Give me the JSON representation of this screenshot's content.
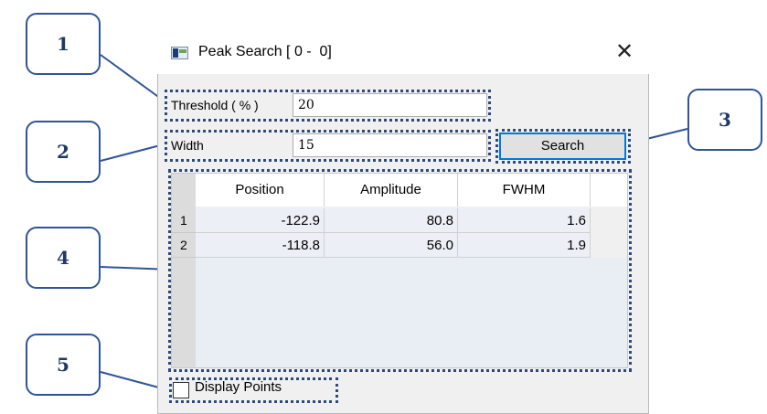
{
  "window": {
    "title": "Peak Search [ 0 -  0]"
  },
  "form": {
    "threshold_label": "Threshold ( % )",
    "threshold_value": "20",
    "width_label": "Width",
    "width_value": "15",
    "search_label": "Search"
  },
  "table": {
    "columns": [
      "Position",
      "Amplitude",
      "FWHM"
    ],
    "rows": [
      {
        "num": "1",
        "position": "-122.9",
        "amplitude": "80.8",
        "fwhm": "1.6"
      },
      {
        "num": "2",
        "position": "-118.8",
        "amplitude": "56.0",
        "fwhm": "1.9"
      }
    ]
  },
  "options": {
    "display_points_label": "Display Points",
    "display_points_checked": false
  },
  "callouts": [
    "1",
    "2",
    "3",
    "4",
    "5"
  ],
  "colors": {
    "accent": "#0078d7",
    "callout_border": "#2f5597",
    "dotted_frame": "#2e4a7d"
  }
}
